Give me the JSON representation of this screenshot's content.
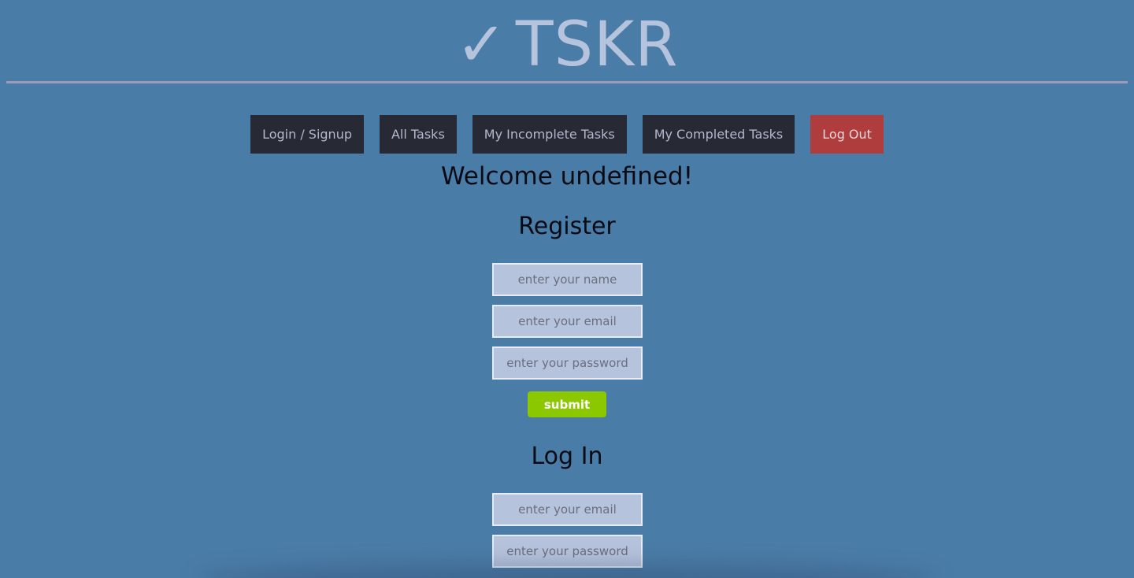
{
  "header": {
    "check_glyph": "✓",
    "title": "TSKR"
  },
  "nav": {
    "items": [
      {
        "label": "Login / Signup"
      },
      {
        "label": "All Tasks"
      },
      {
        "label": "My Incomplete Tasks"
      },
      {
        "label": "My Completed Tasks"
      },
      {
        "label": "Log Out"
      }
    ]
  },
  "welcome": "Welcome undefined!",
  "register": {
    "title": "Register",
    "name_placeholder": "enter your name",
    "email_placeholder": "enter your email",
    "password_placeholder": "enter your password",
    "submit_label": "submit"
  },
  "login": {
    "title": "Log In",
    "email_placeholder": "enter your email",
    "password_placeholder": "enter your password"
  },
  "colors": {
    "background": "#4a7ca8",
    "nav_button": "#272935",
    "logout_button": "#b03d3e",
    "submit_button": "#8cc800",
    "input_fill": "#b6c3dd"
  }
}
